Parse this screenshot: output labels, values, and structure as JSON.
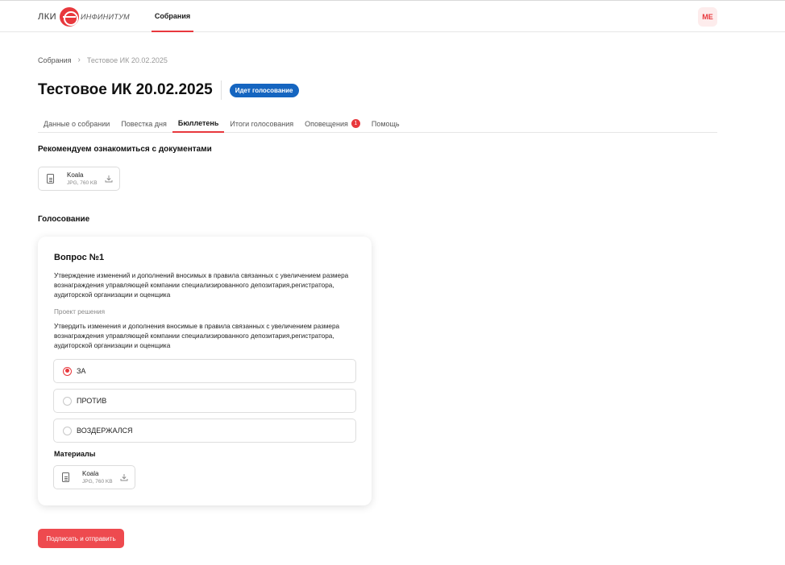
{
  "header": {
    "logo_prefix": "ЛКИ",
    "logo_brand": "ИНФИНИТУМ",
    "nav_active": "Собрания",
    "avatar_initials": "МЕ"
  },
  "breadcrumb": {
    "root": "Собрания",
    "current": "Тестовое ИК 20.02.2025"
  },
  "page": {
    "title": "Тестовое ИК 20.02.2025",
    "status": "Идет голосование"
  },
  "tabs": [
    {
      "label": "Данные о собрании"
    },
    {
      "label": "Повестка дня"
    },
    {
      "label": "Бюллетень",
      "active": true
    },
    {
      "label": "Итоги голосования"
    },
    {
      "label": "Оповещения",
      "badge": "1"
    },
    {
      "label": "Помощь"
    }
  ],
  "documents": {
    "heading": "Рекомендуем ознакомиться с документами",
    "file": {
      "name": "Koala",
      "meta": "JPG, 760 KB"
    }
  },
  "voting": {
    "heading": "Голосование",
    "question": {
      "title": "Вопрос №1",
      "text": "Утверждение изменений и дополнений вносимых в правила связанных с увеличением размера вознаграждения управляющей компании специализированного депозитария,регистратора, аудиторской организации и оценщика",
      "project_label": "Проект решения",
      "project_text": "Утвердить изменения и дополнения вносимые в правила связанных с увеличением размера вознаграждения управляющей компании специализированного депозитария,регистратора, аудиторской организации и оценщика",
      "options": [
        {
          "label": "ЗА",
          "selected": true
        },
        {
          "label": "ПРОТИВ",
          "selected": false
        },
        {
          "label": "ВОЗДЕРЖАЛСЯ",
          "selected": false
        }
      ],
      "materials_label": "Материалы",
      "material_file": {
        "name": "Koala",
        "meta": "JPG, 760 KB"
      }
    }
  },
  "submit_label": "Подписать и отправить",
  "colors": {
    "accent": "#e8383d",
    "status_badge": "#1565c0"
  }
}
